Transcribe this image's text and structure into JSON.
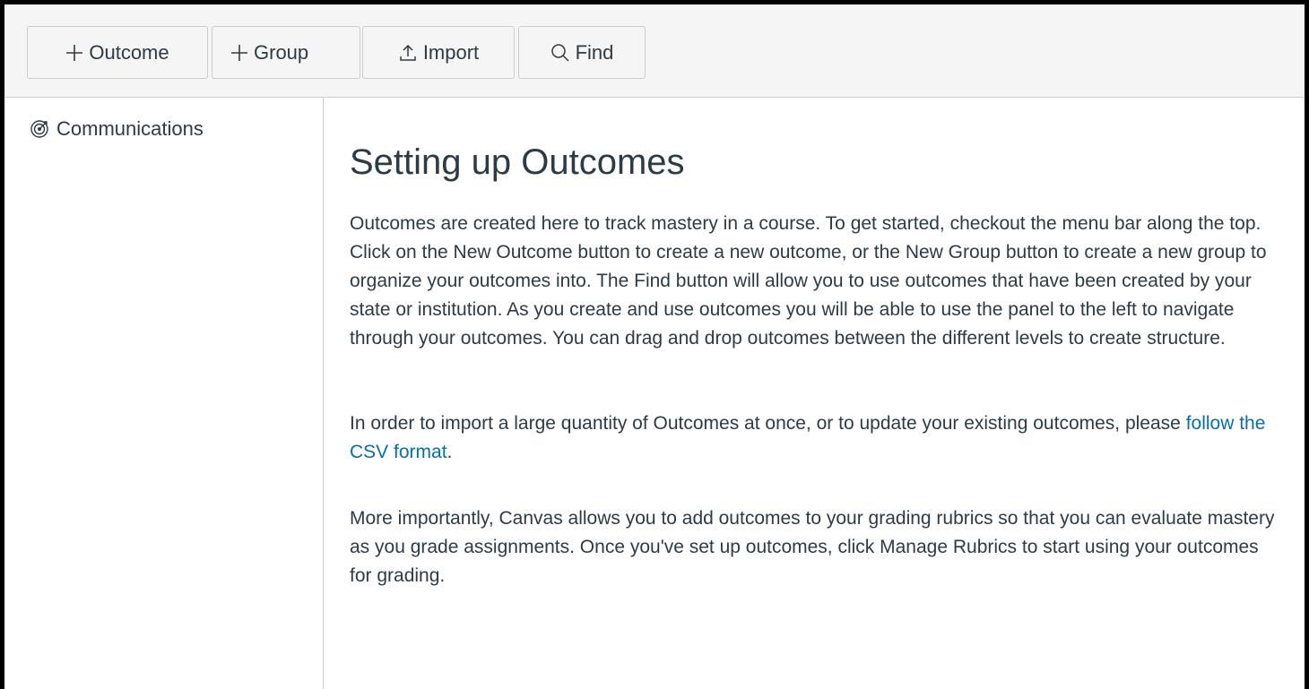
{
  "toolbar": {
    "outcome_label": "Outcome",
    "group_label": "Group",
    "import_label": "Import",
    "find_label": "Find"
  },
  "sidebar": {
    "items": [
      {
        "label": "Communications",
        "icon": "outcomes-target-icon"
      }
    ]
  },
  "main": {
    "title": "Setting up Outcomes",
    "p1": "Outcomes are created here to track mastery in a course. To get started, checkout the menu bar along the top. Click on the New Outcome button to create a new outcome, or the New Group button to create a new group to organize your outcomes into. The Find button will allow you to use outcomes that have been created by your state or institution. As you create and use outcomes you will be able to use the panel to the left to navigate through your outcomes. You can drag and drop outcomes between the different levels to create structure.",
    "p2_before": "In order to import a large quantity of Outcomes at once, or to update your existing outcomes, please ",
    "p2_link": "follow the CSV format",
    "p2_after": ".",
    "p3": "More importantly, Canvas allows you to add outcomes to your grading rubrics so that you can evaluate mastery as you grade assignments. Once you've set up outcomes, click Manage Rubrics to start using your outcomes for grading."
  },
  "colors": {
    "text": "#2d3b45",
    "link": "#0770a3",
    "toolbar_bg": "#f5f5f5",
    "border": "#c7cdd1"
  }
}
